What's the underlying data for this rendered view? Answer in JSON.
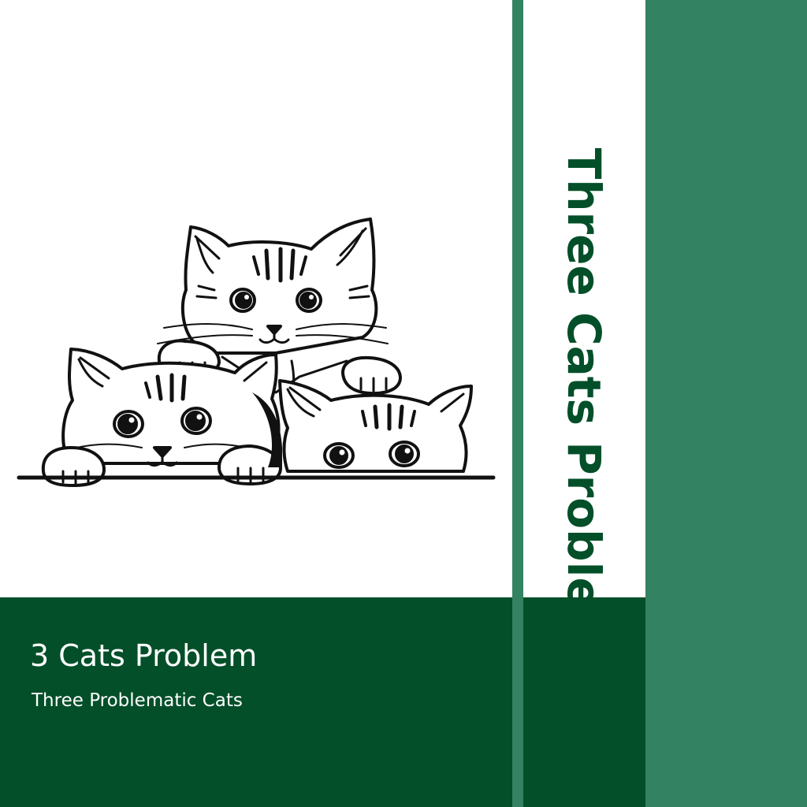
{
  "cover": {
    "spine_title": "Three Cats Problem",
    "title": "3 Cats Problem",
    "subtitle": "Three Problematic Cats"
  },
  "colors": {
    "dark_green": "#034f29",
    "medium_green": "#338262",
    "white": "#ffffff",
    "ink": "#111111"
  },
  "illustration": {
    "icon": "three-kittens-peeking-line-art"
  }
}
